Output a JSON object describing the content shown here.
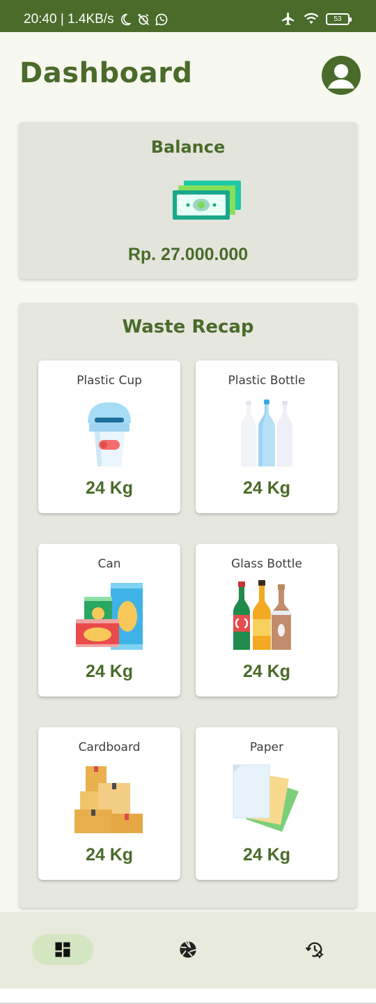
{
  "status_bar": {
    "time_speed": "20:40 | 1.4KB/s",
    "battery": "53",
    "icons": [
      "moon-icon",
      "alarm-off-icon",
      "whatsapp-icon",
      "airplane-icon",
      "wifi-icon",
      "battery-icon"
    ]
  },
  "header": {
    "title": "Dashboard",
    "profile_icon": "profile-icon"
  },
  "balance": {
    "title": "Balance",
    "icon": "money-icon",
    "value": "Rp. 27.000.000"
  },
  "waste_recap": {
    "title": "Waste Recap",
    "items": [
      {
        "label": "Plastic Cup",
        "weight": "24 Kg",
        "icon": "plastic-cup-icon"
      },
      {
        "label": "Plastic Bottle",
        "weight": "24 Kg",
        "icon": "plastic-bottle-icon"
      },
      {
        "label": "Can",
        "weight": "24 Kg",
        "icon": "can-icon"
      },
      {
        "label": "Glass Bottle",
        "weight": "24 Kg",
        "icon": "glass-bottle-icon"
      },
      {
        "label": "Cardboard",
        "weight": "24 Kg",
        "icon": "cardboard-icon"
      },
      {
        "label": "Paper",
        "weight": "24 Kg",
        "icon": "paper-icon"
      }
    ]
  },
  "bottom_nav": {
    "items": [
      {
        "icon": "dashboard-icon",
        "active": true
      },
      {
        "icon": "camera-shutter-icon",
        "active": false
      },
      {
        "icon": "history-settings-icon",
        "active": false
      }
    ]
  },
  "colors": {
    "primary": "#4a6b2a",
    "background": "#f7f8ef",
    "card": "#e3e4dc",
    "nav_background": "#e8eadd",
    "nav_active": "#d4e5c1"
  }
}
